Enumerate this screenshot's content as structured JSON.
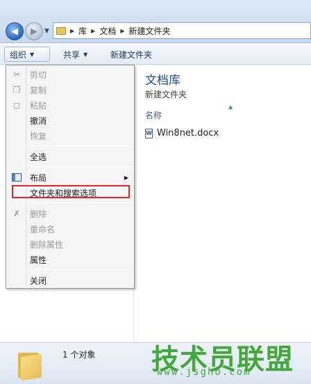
{
  "address": {
    "crumbs": [
      "库",
      "文档",
      "新建文件夹"
    ]
  },
  "toolbar": {
    "organize_label": "组织",
    "share_label": "共享",
    "new_folder_label": "新建文件夹"
  },
  "content": {
    "library_title": "文档库",
    "library_subtitle": "新建文件夹",
    "column_name": "名称",
    "files": [
      {
        "name": "Win8net.docx",
        "icon": "word-doc-icon"
      }
    ]
  },
  "menu": {
    "items": [
      {
        "label": "剪切",
        "icon": "scissors-icon",
        "disabled": true
      },
      {
        "label": "复制",
        "icon": "copy-icon",
        "disabled": true
      },
      {
        "label": "粘贴",
        "icon": "paste-icon",
        "disabled": false
      },
      {
        "label": "撤消",
        "icon": "",
        "disabled": false
      },
      {
        "label": "恢复",
        "icon": "",
        "disabled": true
      },
      {
        "label": "全选",
        "icon": "",
        "disabled": false
      },
      {
        "label": "布局",
        "icon": "layout-icon",
        "disabled": false,
        "submenu": true
      },
      {
        "label": "文件夹和搜索选项",
        "icon": "",
        "disabled": false,
        "highlighted": true
      },
      {
        "label": "删除",
        "icon": "delete-x-icon",
        "disabled": true
      },
      {
        "label": "重命名",
        "icon": "",
        "disabled": true
      },
      {
        "label": "删除属性",
        "icon": "",
        "disabled": true
      },
      {
        "label": "属性",
        "icon": "",
        "disabled": false
      },
      {
        "label": "关闭",
        "icon": "",
        "disabled": false
      }
    ],
    "highlight_color": "#e0262a"
  },
  "status": {
    "count_text": "1 个对象"
  },
  "watermark": {
    "title": "技术员联盟",
    "url": "www.jsgho.com",
    "color": "#45a83c"
  }
}
